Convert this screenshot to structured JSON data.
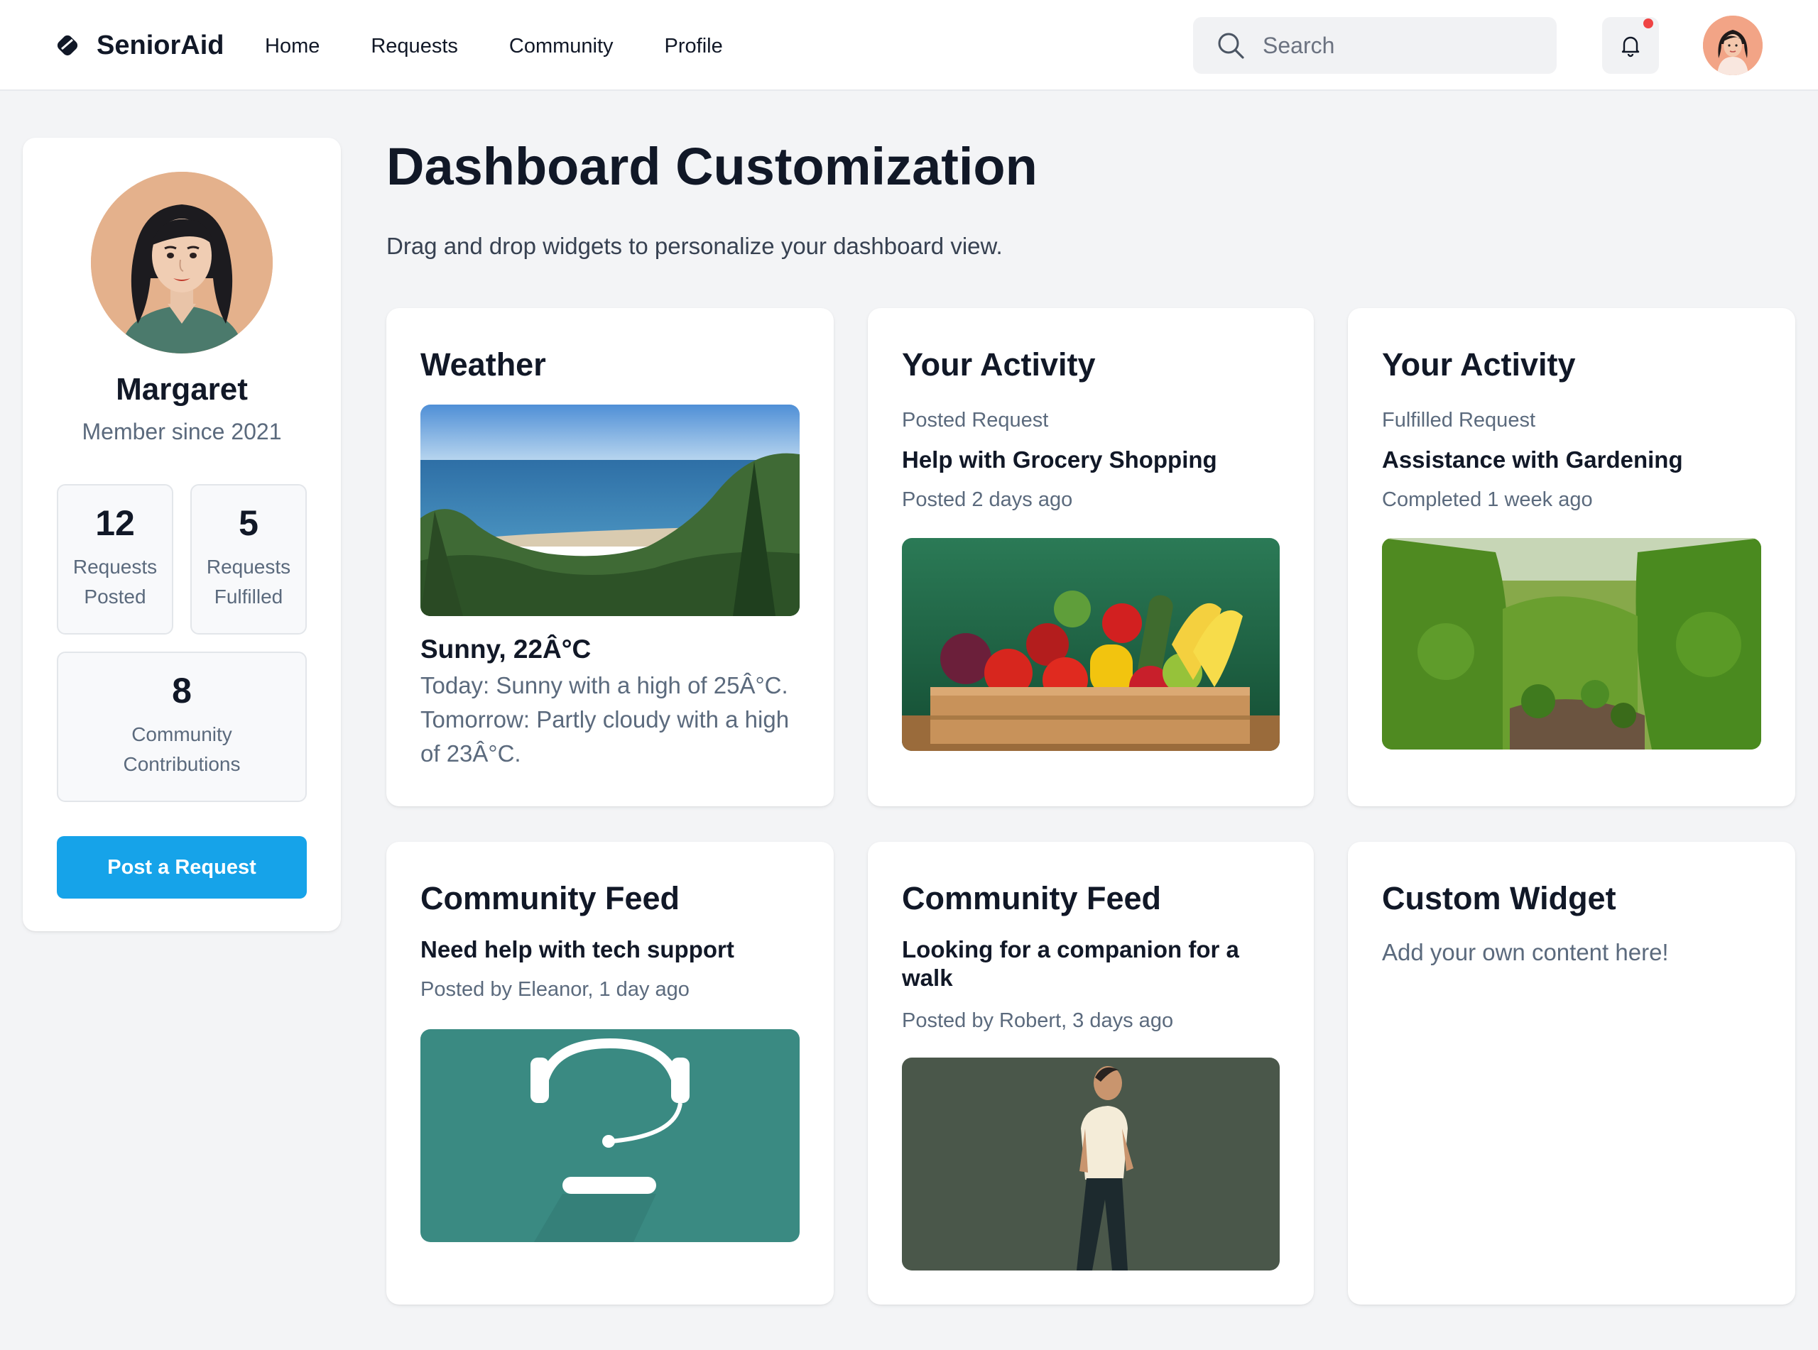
{
  "header": {
    "brand": "SeniorAid",
    "nav": [
      "Home",
      "Requests",
      "Community",
      "Profile"
    ],
    "search_placeholder": "Search"
  },
  "profile": {
    "name": "Margaret",
    "member_since": "Member since 2021",
    "stats": [
      {
        "value": "12",
        "label_line1": "Requests",
        "label_line2": "Posted"
      },
      {
        "value": "5",
        "label_line1": "Requests",
        "label_line2": "Fulfilled"
      },
      {
        "value": "8",
        "label_line1": "Community",
        "label_line2": "Contributions"
      }
    ],
    "post_button": "Post a Request"
  },
  "page": {
    "title": "Dashboard Customization",
    "subtitle": "Drag and drop widgets to personalize your dashboard view."
  },
  "widgets": {
    "weather": {
      "title": "Weather",
      "condition": "Sunny, 22Â°C",
      "description": "Today: Sunny with a high of 25Â°C. Tomorrow: Partly cloudy with a high of 23Â°C."
    },
    "activity_posted": {
      "title": "Your Activity",
      "label": "Posted Request",
      "heading": "Help with Grocery Shopping",
      "meta": "Posted 2 days ago"
    },
    "activity_fulfilled": {
      "title": "Your Activity",
      "label": "Fulfilled Request",
      "heading": "Assistance with Gardening",
      "meta": "Completed 1 week ago"
    },
    "feed_tech": {
      "title": "Community Feed",
      "heading": "Need help with tech support",
      "meta": "Posted by Eleanor, 1 day ago"
    },
    "feed_walk": {
      "title": "Community Feed",
      "heading": "Looking for a companion for a walk",
      "meta": "Posted by Robert, 3 days ago"
    },
    "custom": {
      "title": "Custom Widget",
      "text": "Add your own content here!"
    }
  },
  "colors": {
    "accent": "#16a3e9",
    "notification": "#ef4444",
    "background": "#f3f4f6"
  }
}
